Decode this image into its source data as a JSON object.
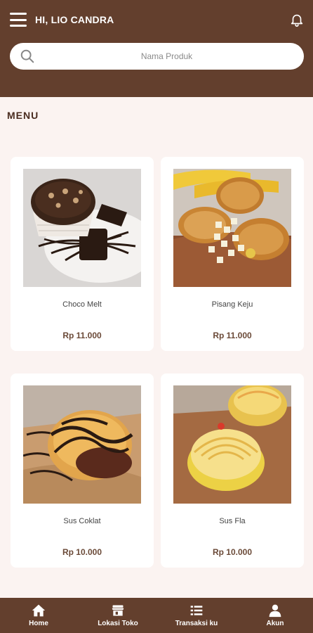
{
  "header": {
    "greeting": "HI, LIO CANDRA",
    "menu_icon": "hamburger-icon",
    "bell_icon": "bell-icon"
  },
  "search": {
    "placeholder": "Nama Produk",
    "icon": "search-icon"
  },
  "section": {
    "title": "MENU"
  },
  "products": [
    {
      "name": "Choco Melt",
      "price": "Rp 11.000"
    },
    {
      "name": "Pisang Keju",
      "price": "Rp 11.000"
    },
    {
      "name": "Sus Coklat",
      "price": "Rp 10.000"
    },
    {
      "name": "Sus Fla",
      "price": "Rp 10.000"
    }
  ],
  "bottom_nav": [
    {
      "label": "Home",
      "icon": "home-icon"
    },
    {
      "label": "Lokasi Toko",
      "icon": "store-icon"
    },
    {
      "label": "Transaksi ku",
      "icon": "list-icon"
    },
    {
      "label": "Akun",
      "icon": "user-icon"
    }
  ],
  "colors": {
    "brand": "#633f2d",
    "background": "#fbf3f1",
    "card": "#ffffff",
    "price": "#6b4a38"
  }
}
